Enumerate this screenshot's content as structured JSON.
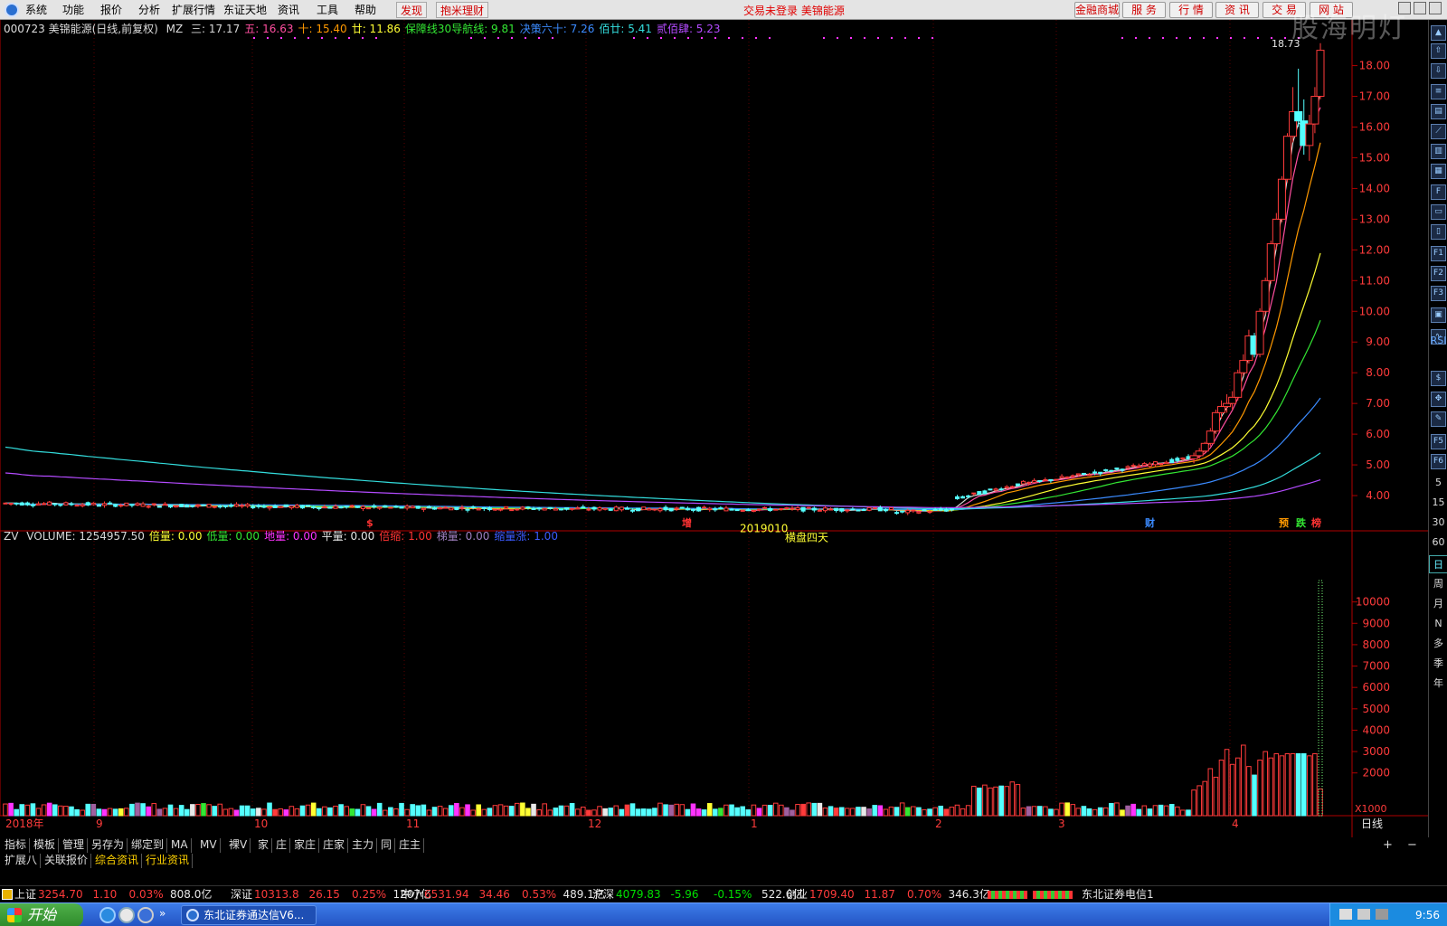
{
  "menu": {
    "items": [
      "系统",
      "功能",
      "报价",
      "分析",
      "扩展行情",
      "东证天地",
      "资讯",
      "工具",
      "帮助"
    ],
    "discover": "发现",
    "finance": "抱米理财",
    "status": "交易未登录  美锦能源",
    "right_buttons": [
      "金融商城",
      "服 务",
      "行 情",
      "资 讯",
      "交 易",
      "网 站"
    ]
  },
  "watermark": "股海明灯",
  "main_legend": {
    "title": "000723 美锦能源(日线,前复权)",
    "indicator": "MZ",
    "items": [
      {
        "label": "三: 17.17",
        "color": "#d8d8d8"
      },
      {
        "label": "五: 16.63",
        "color": "#ff4fa0"
      },
      {
        "label": "十: 15.40",
        "color": "#ff9900"
      },
      {
        "label": "廿: 11.86",
        "color": "#ffff33"
      },
      {
        "label": "保障线30导航线: 9.81",
        "color": "#33e633"
      },
      {
        "label": "决策六十: 7.26",
        "color": "#3b8bff"
      },
      {
        "label": "佰廿: 5.41",
        "color": "#33dddd"
      },
      {
        "label": "贰佰肆: 5.23",
        "color": "#b44bff"
      }
    ]
  },
  "price_axis": {
    "ticks": [
      "18.00",
      "17.00",
      "16.00",
      "15.00",
      "14.00",
      "13.00",
      "12.00",
      "11.00",
      "10.00",
      "9.00",
      "8.00",
      "7.00",
      "6.00",
      "5.00",
      "4.00"
    ],
    "high_label": "18.73",
    "low_label": "2019010",
    "low_text": "横盘四天"
  },
  "event_marks": [
    {
      "label": "$",
      "color": "#ff3333"
    },
    {
      "label": "增",
      "color": "#ff3333"
    },
    {
      "label": "财",
      "color": "#3b8bff"
    },
    {
      "label": "预",
      "color": "#ff9900"
    },
    {
      "label": "跌",
      "color": "#33e633"
    },
    {
      "label": "榜",
      "color": "#ff3333"
    }
  ],
  "volume_legend": {
    "indicator": "ZV",
    "items": [
      {
        "label": "VOLUME: 1254957.50",
        "color": "#d8d8d8"
      },
      {
        "label": "倍量: 0.00",
        "color": "#ffff33"
      },
      {
        "label": "低量: 0.00",
        "color": "#33e633"
      },
      {
        "label": "地量: 0.00",
        "color": "#ff33ff"
      },
      {
        "label": "平量: 0.00",
        "color": "#e8e8e8"
      },
      {
        "label": "倍缩: 1.00",
        "color": "#ff3333"
      },
      {
        "label": "梯量: 0.00",
        "color": "#a080c0"
      },
      {
        "label": "缩量涨: 1.00",
        "color": "#3b5bff"
      }
    ]
  },
  "volume_axis": {
    "ticks": [
      "10000",
      "9000",
      "8000",
      "7000",
      "6000",
      "5000",
      "4000",
      "3000",
      "2000"
    ],
    "unit": "X1000"
  },
  "date_axis": {
    "labels": [
      "2018年",
      "9",
      "10",
      "11",
      "12",
      "1",
      "2",
      "3",
      "4"
    ],
    "period": "日线"
  },
  "right_toolbar": {
    "numbers": [
      "5",
      "15",
      "30",
      "60"
    ],
    "periods": [
      "日",
      "周",
      "月",
      "N",
      "多",
      "季",
      "年"
    ],
    "rsi": "RSI"
  },
  "tabs_row1": [
    "指标",
    "模板",
    "管理",
    "另存为",
    "绑定到",
    "MA",
    "MV",
    "裸V",
    "家",
    "庄",
    "家庄",
    "庄家",
    "主力",
    "同",
    "庄主"
  ],
  "tabs_row2": [
    "扩展八",
    "关联报价",
    "综合资讯",
    "行业资讯"
  ],
  "ticker": {
    "items": [
      {
        "name": "上证",
        "value": "3254.70",
        "change": "1.10",
        "pct": "0.03%",
        "amount": "808.0亿",
        "dir": "up"
      },
      {
        "name": "深证",
        "value": "10313.8",
        "change": "26.15",
        "pct": "0.25%",
        "amount": "1207亿",
        "dir": "up"
      },
      {
        "name": "中小",
        "value": "6531.94",
        "change": "34.46",
        "pct": "0.53%",
        "amount": "489.1亿",
        "dir": "up"
      },
      {
        "name": "沪深",
        "value": "4079.83",
        "change": "-5.96",
        "pct": "-0.15%",
        "amount": "522.6亿",
        "dir": "down"
      },
      {
        "name": "创业",
        "value": "1709.40",
        "change": "11.87",
        "pct": "0.70%",
        "amount": "346.3亿",
        "dir": "up"
      }
    ],
    "server": "东北证券电信1"
  },
  "taskbar": {
    "start": "开始",
    "task_title": "东北证券通达信V6...",
    "clock": "9:56"
  },
  "chart_data": {
    "type": "candlestick",
    "price_ylim": [
      3.0,
      18.9
    ],
    "price_ohlc_recent": [
      [
        5.2,
        5.4,
        5.05,
        5.3
      ],
      [
        5.3,
        5.55,
        5.2,
        5.45
      ],
      [
        5.45,
        5.75,
        5.35,
        5.7
      ],
      [
        5.7,
        6.2,
        5.6,
        6.1
      ],
      [
        6.1,
        6.8,
        6.0,
        6.7
      ],
      [
        6.7,
        7.1,
        6.5,
        6.9
      ],
      [
        6.9,
        7.3,
        6.7,
        7.0
      ],
      [
        7.0,
        7.4,
        6.8,
        7.2
      ],
      [
        7.2,
        8.1,
        7.1,
        8.0
      ],
      [
        8.0,
        8.6,
        7.9,
        8.4
      ],
      [
        8.4,
        9.4,
        8.3,
        9.2
      ],
      [
        9.2,
        9.3,
        8.5,
        8.6
      ],
      [
        8.6,
        10.1,
        8.5,
        10.0
      ],
      [
        10.0,
        11.1,
        9.9,
        11.0
      ],
      [
        11.0,
        12.3,
        10.9,
        12.2
      ],
      [
        12.2,
        13.2,
        12.0,
        13.0
      ],
      [
        13.0,
        14.4,
        12.9,
        14.3
      ],
      [
        14.3,
        15.8,
        14.2,
        15.7
      ],
      [
        15.7,
        17.3,
        15.5,
        16.5
      ],
      [
        16.5,
        17.9,
        16.0,
        16.2
      ],
      [
        16.2,
        16.9,
        15.1,
        15.4
      ],
      [
        15.4,
        16.4,
        14.9,
        16.1
      ],
      [
        16.1,
        17.3,
        15.8,
        17.0
      ],
      [
        17.0,
        18.73,
        16.9,
        18.5
      ]
    ],
    "volume_ylim": [
      0,
      11000
    ],
    "volume_recent": [
      1200,
      1400,
      1600,
      2200,
      1800,
      2600,
      3100,
      2400,
      2700,
      3300,
      2300,
      1900,
      2600,
      3000,
      2700,
      2900,
      2800,
      2900,
      2900,
      2900,
      2900,
      2800,
      2900,
      1250
    ]
  }
}
